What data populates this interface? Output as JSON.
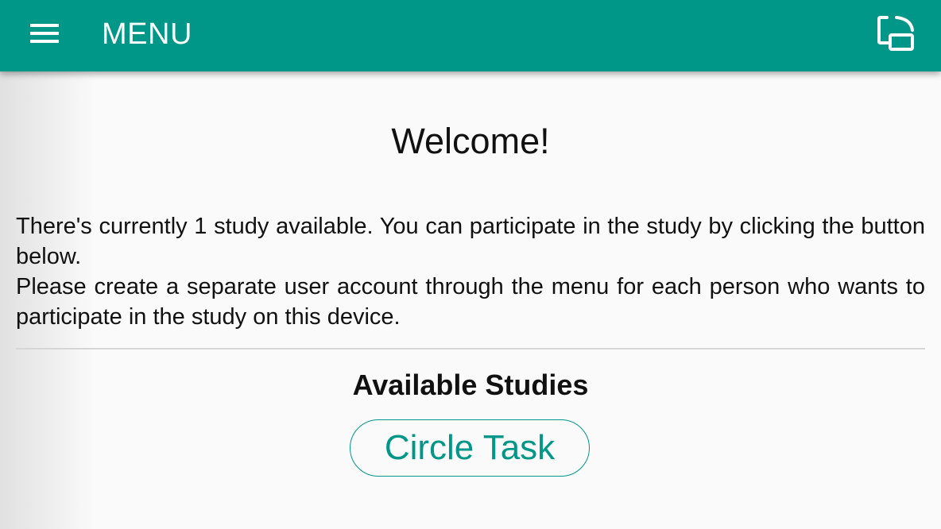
{
  "appbar": {
    "title": "MENU",
    "menu_icon": "hamburger-menu-icon",
    "rotate_icon": "screen-rotation-icon",
    "color": "#009688"
  },
  "main": {
    "welcome": "Welcome!",
    "intro_line1": "There's currently 1 study available. You can participate in the study by clicking the button below.",
    "intro_line2": "Please create a separate user account through the menu for each person who wants to participate in the study on this device.",
    "studies_heading": "Available Studies",
    "studies": [
      {
        "label": "Circle Task"
      }
    ]
  }
}
